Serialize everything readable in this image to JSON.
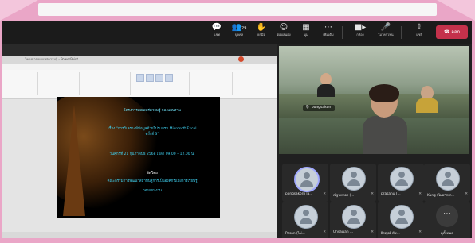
{
  "toolbar": {
    "items": [
      {
        "icon": "chat-icon",
        "label": "แชท"
      },
      {
        "icon": "people-icon",
        "label": "บุคคล",
        "count": "29"
      },
      {
        "icon": "raise-hand-icon",
        "label": "ยกมือ"
      },
      {
        "icon": "reactions-icon",
        "label": "ตอบสนอง"
      },
      {
        "icon": "view-icon",
        "label": "มุม"
      },
      {
        "icon": "more-icon",
        "label": "เพิ่มเติม"
      },
      {
        "icon": "camera-icon",
        "label": "กล้อง"
      },
      {
        "icon": "mic-icon",
        "label": "ไมโครโฟน"
      },
      {
        "icon": "share-icon",
        "label": "แชร์"
      }
    ],
    "leave_label": "ออก",
    "colors": {
      "leave": "#c4314b"
    }
  },
  "shared_window": {
    "title": "โครงการเผยแพร่ความรู้ - PowerPoint"
  },
  "slide": {
    "lines": [
      "โครงการเผยแพร่ความรู้ กองแผนงาน",
      "เรื่อง \"การวิเคราะห์ข้อมูลด้วยโปรแกรม Microsoft Excel",
      "ครั้งที่ 3\"",
      "วันศุกร์ที่ 21 กุมภาพันธ์ 2568 เวลา 09.00 – 12.00 น.",
      "จัดโดย",
      "คณะกรรมการพัฒนาสถาบันสู่การเป็นองค์กรแห่งการเรียนรู้",
      "กองแผนงาน"
    ]
  },
  "stage": {
    "speaker_label": "pongsakorn"
  },
  "participants": [
    {
      "name": "pongsakorn la...",
      "highlighted": true
    },
    {
      "name": "ณัฐปุยทอง (...",
      "highlighted": false
    },
    {
      "name": "prasanu (...",
      "highlighted": false
    },
    {
      "name": "Kung (ไม่ฝากเก...",
      "highlighted": false
    },
    {
      "name": "Pasan (ไม่...",
      "highlighted": false
    },
    {
      "name": "Unsawan ...",
      "highlighted": false
    },
    {
      "name": "ผิรญณ์ พัช...",
      "highlighted": false
    }
  ],
  "more_tile": {
    "label": "ดูทั้งหมด",
    "symbol": "⋯"
  }
}
